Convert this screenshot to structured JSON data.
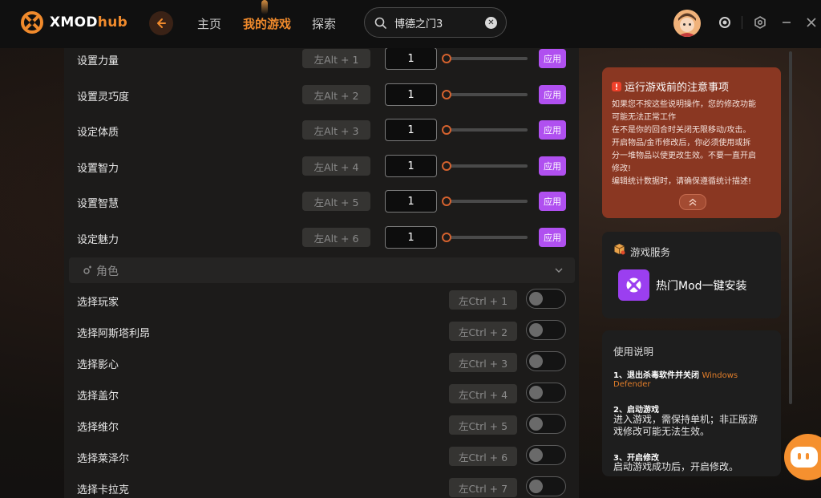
{
  "app": {
    "logo_prefix": "XMOD",
    "logo_suffix": "hub",
    "accent_color": "#f08a2c"
  },
  "nav": {
    "items": [
      {
        "label": "主页",
        "active": false
      },
      {
        "label": "我的游戏",
        "active": true
      },
      {
        "label": "探索",
        "active": false
      }
    ]
  },
  "search": {
    "value": "博德之门3"
  },
  "attributes": [
    {
      "label": "设置力量",
      "hotkey": "左Alt + 1",
      "value": "1",
      "apply": "应用"
    },
    {
      "label": "设置灵巧度",
      "hotkey": "左Alt + 2",
      "value": "1",
      "apply": "应用"
    },
    {
      "label": "设定体质",
      "hotkey": "左Alt + 3",
      "value": "1",
      "apply": "应用"
    },
    {
      "label": "设置智力",
      "hotkey": "左Alt + 4",
      "value": "1",
      "apply": "应用"
    },
    {
      "label": "设置智慧",
      "hotkey": "左Alt + 5",
      "value": "1",
      "apply": "应用"
    },
    {
      "label": "设定魅力",
      "hotkey": "左Alt + 6",
      "value": "1",
      "apply": "应用"
    }
  ],
  "section": {
    "title": "角色"
  },
  "characters": [
    {
      "label": "选择玩家",
      "hotkey": "左Ctrl + 1",
      "on": false
    },
    {
      "label": "选择阿斯塔利昂",
      "hotkey": "左Ctrl + 2",
      "on": false
    },
    {
      "label": "选择影心",
      "hotkey": "左Ctrl + 3",
      "on": false
    },
    {
      "label": "选择盖尔",
      "hotkey": "左Ctrl + 4",
      "on": false
    },
    {
      "label": "选择维尔",
      "hotkey": "左Ctrl + 5",
      "on": false
    },
    {
      "label": "选择莱泽尔",
      "hotkey": "左Ctrl + 6",
      "on": false
    },
    {
      "label": "选择卡拉克",
      "hotkey": "左Ctrl + 7",
      "on": false
    }
  ],
  "notice": {
    "title": "运行游戏前的注意事项",
    "lines": [
      "如果您不按这些说明操作，您的修改功能",
      "可能无法正常工作",
      "在不是你的回合时关闭无限移动/攻击。",
      "开启物品/金币修改后，你必须使用或拆",
      "分一堆物品以使更改生效。不要一直开启",
      "修改!",
      "编辑统计数据时，请确保遵循统计描述!"
    ],
    "color": "#8a3722"
  },
  "services": {
    "title": "游戏服务",
    "mod_button": "热门Mod一键安装"
  },
  "usage": {
    "title": "使用说明",
    "step1_title": "1、退出杀毒软件并关闭",
    "step1_highlight": "Windows",
    "step1_highlight2": "Defender",
    "step2_title": "2、启动游戏",
    "step2_desc1": "进入游戏，需保持单机；非正版游",
    "step2_desc2": "戏修改可能无法生效。",
    "step3_title": "3、开启修改",
    "step3_desc": "启动游戏成功后，开启修改。"
  }
}
